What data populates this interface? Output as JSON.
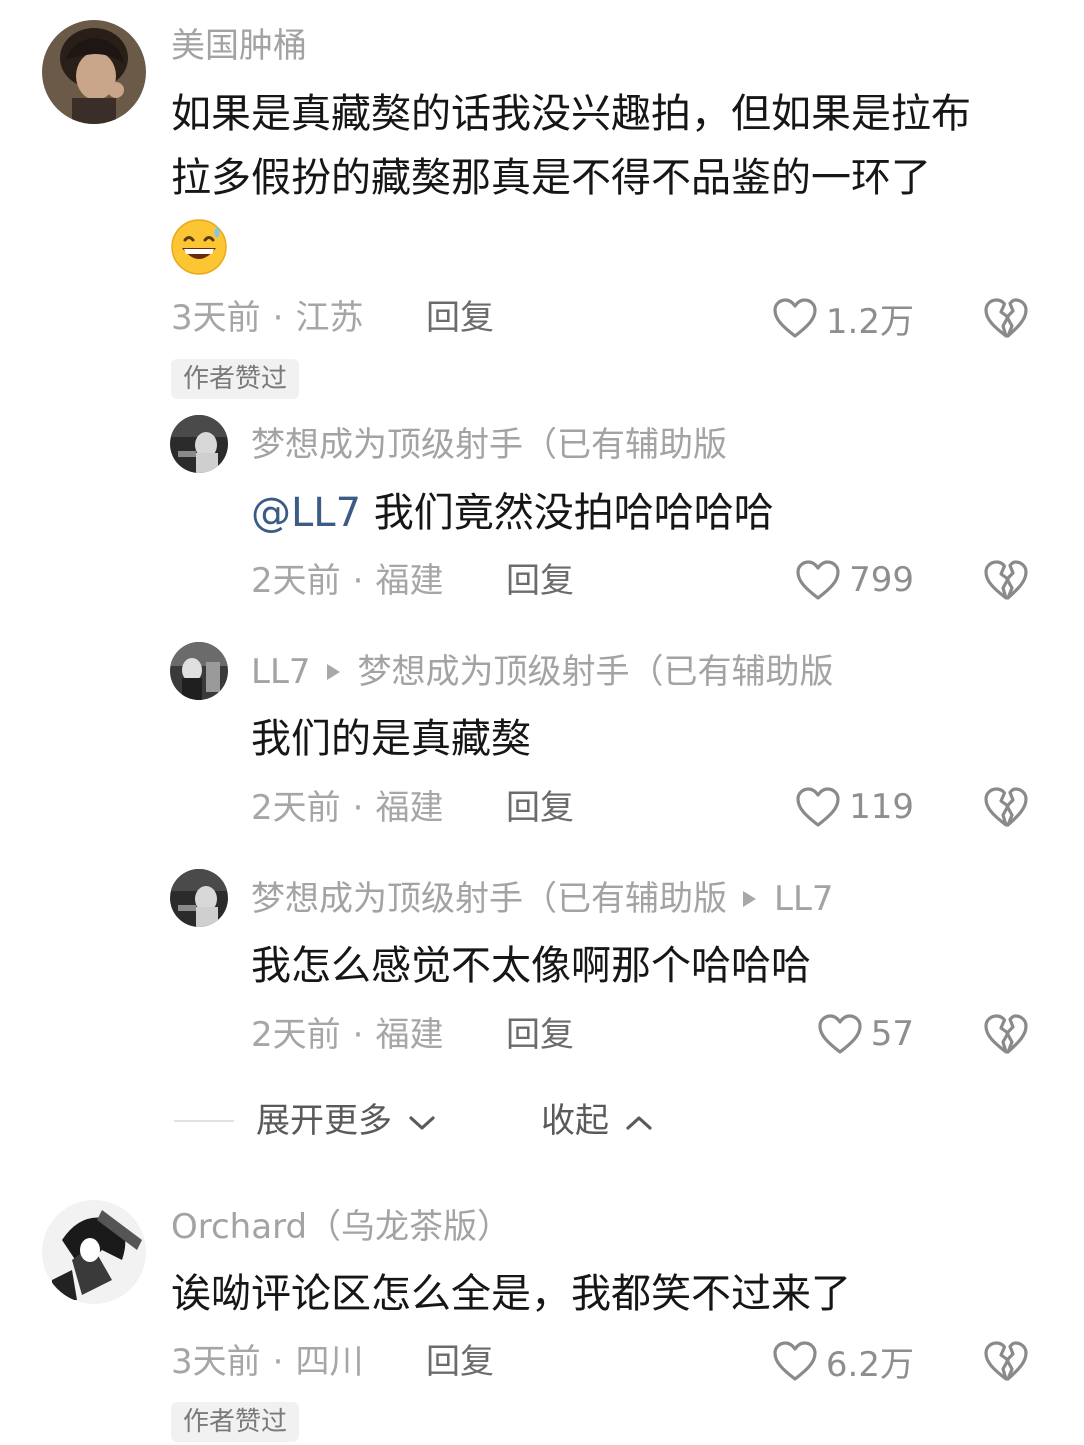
{
  "colors": {
    "username": "#a3a3a3",
    "content": "#161616",
    "mention": "#3c5c85",
    "meta": "#a6a6a6",
    "badge_bg": "#f1f1f1"
  },
  "comments": [
    {
      "username": "美国肿桶",
      "content_lines": [
        "如果是真藏獒的话我没兴趣拍，但如果是拉布",
        "拉多假扮的藏獒那真是不得不品鉴的一环了"
      ],
      "emoji": "grinning-sweat-emoji",
      "time": "3天前",
      "location": "江苏",
      "reply_label": "回复",
      "likes": "1.2万",
      "badge": "作者赞过",
      "replies": [
        {
          "username": "梦想成为顶级射手（已有辅助版",
          "mention": "@LL7",
          "content": " 我们竟然没拍哈哈哈哈",
          "time": "2天前",
          "location": "福建",
          "reply_label": "回复",
          "likes": "799"
        },
        {
          "username": "LL7",
          "reply_to": "梦想成为顶级射手（已有辅助版",
          "content": "我们的是真藏獒",
          "time": "2天前",
          "location": "福建",
          "reply_label": "回复",
          "likes": "119"
        },
        {
          "username": "梦想成为顶级射手（已有辅助版",
          "reply_to": "LL7",
          "content": "我怎么感觉不太像啊那个哈哈哈",
          "time": "2天前",
          "location": "福建",
          "reply_label": "回复",
          "likes": "57"
        }
      ],
      "expand_label": "展开更多",
      "collapse_label": "收起"
    },
    {
      "username": "Orchard（乌龙茶版）",
      "content_lines": [
        "诶呦评论区怎么全是，我都笑不过来了"
      ],
      "time": "3天前",
      "location": "四川",
      "reply_label": "回复",
      "likes": "6.2万",
      "badge": "作者赞过"
    }
  ],
  "separator": "·"
}
